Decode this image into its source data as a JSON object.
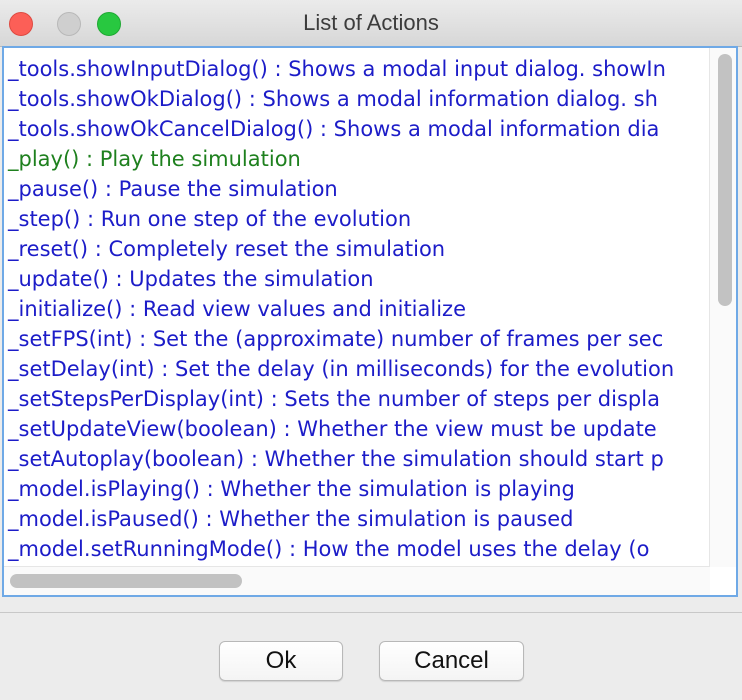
{
  "window": {
    "title": "List of Actions",
    "colors": {
      "close": "#fc5f57",
      "minimize": "#cfcfcf",
      "maximize": "#28c840",
      "item_text": "#1c1cc8",
      "highlight_text": "#1e801e",
      "focus_border": "#6fa9e6"
    }
  },
  "actions": [
    "_tools.showInputDialog() : Shows a modal input dialog. showIn",
    "_tools.showOkDialog() : Shows a modal information dialog. sh",
    "_tools.showOkCancelDialog() : Shows a modal information dia",
    "_play() : Play the simulation",
    "_pause() : Pause the simulation",
    "_step() : Run one step of the evolution",
    "_reset() : Completely reset the simulation",
    "_update() : Updates the simulation",
    "_initialize() : Read view values and initialize",
    "_setFPS(int) : Set the (approximate) number of frames per sec",
    "_setDelay(int) : Set the delay (in milliseconds) for the evolution",
    "_setStepsPerDisplay(int) : Sets the number of steps per displa",
    "_setUpdateView(boolean) : Whether the view must be update",
    "_setAutoplay(boolean) : Whether the simulation should start p",
    "_model.isPlaying() : Whether the simulation is playing",
    "_model.isPaused() : Whether the simulation is paused",
    "_model.setRunningMode() : How the model uses the delay (o"
  ],
  "highlighted_index": 3,
  "buttons": {
    "ok": "Ok",
    "cancel": "Cancel"
  }
}
